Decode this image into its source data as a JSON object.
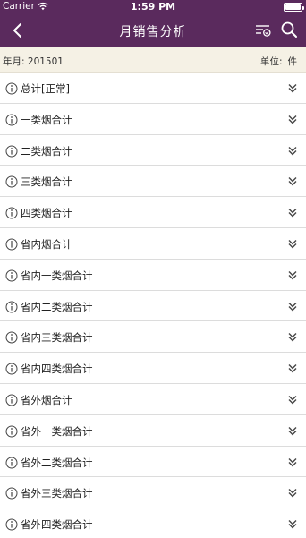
{
  "status": {
    "carrier": "Carrier",
    "time": "1:59 PM"
  },
  "nav": {
    "title": "月销售分析"
  },
  "info": {
    "period_label": "年月:",
    "period_value": "201501",
    "unit_label": "单位:",
    "unit_value": "件"
  },
  "list": [
    "总计[正常]",
    "一类烟合计",
    "二类烟合计",
    "三类烟合计",
    "四类烟合计",
    "省内烟合计",
    "省内一类烟合计",
    "省内二类烟合计",
    "省内三类烟合计",
    "省内四类烟合计",
    "省外烟合计",
    "省外一类烟合计",
    "省外二类烟合计",
    "省外三类烟合计",
    "省外四类烟合计"
  ],
  "colors": {
    "header": "#5a2a5d",
    "infobar": "#f5f1e5"
  },
  "icons": {
    "row": "info-circle-icon",
    "expand": "double-chevron-down-icon"
  }
}
